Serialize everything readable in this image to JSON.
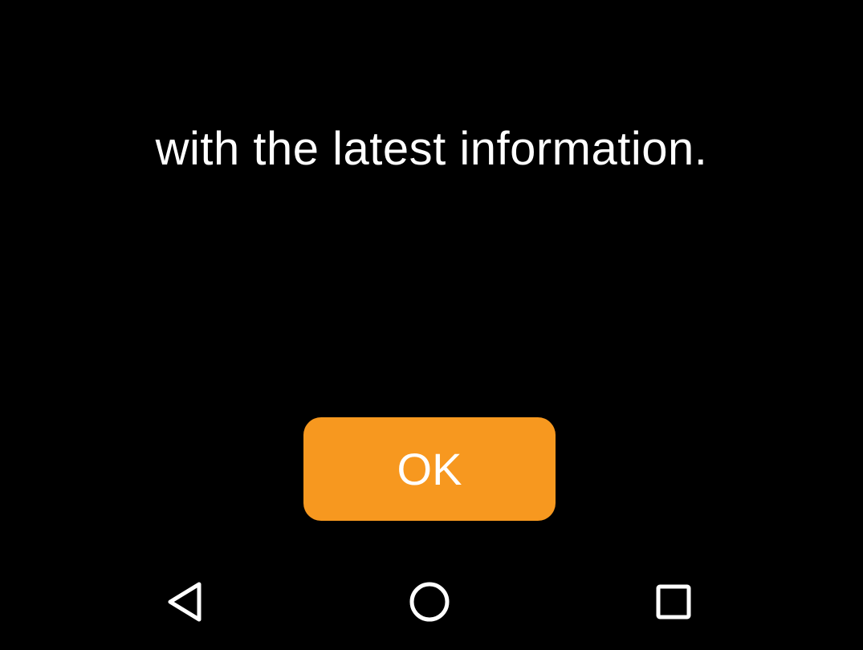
{
  "dialog": {
    "message": "with the latest information.",
    "ok_label": "OK",
    "accent_color": "#f7981f"
  },
  "nav_bar": {
    "buttons": [
      {
        "name": "back",
        "icon": "triangle-back-icon"
      },
      {
        "name": "home",
        "icon": "circle-home-icon"
      },
      {
        "name": "recents",
        "icon": "square-recents-icon"
      }
    ]
  }
}
